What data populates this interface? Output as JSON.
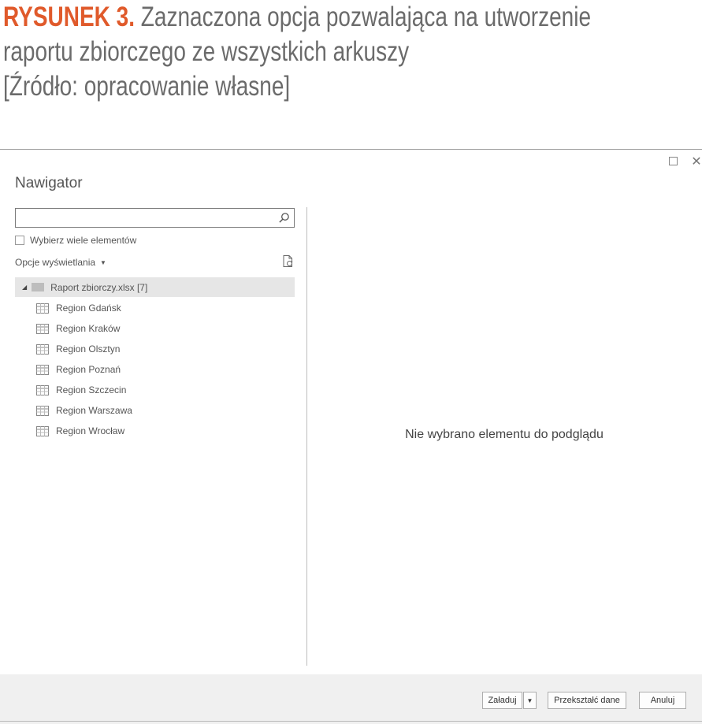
{
  "caption": {
    "figure_label": "RYSUNEK 3.",
    "line1": "Zaznaczona opcja pozwalająca na utworzenie",
    "line2": "raportu zbiorczego ze wszystkich arkuszy",
    "line3": "[Źródło: opracowanie własne]"
  },
  "window": {
    "maximize_icon": "maximize-icon",
    "close_glyph": "✕"
  },
  "navigator": {
    "title": "Nawigator",
    "search": {
      "value": "",
      "placeholder": ""
    },
    "multi_select_label": "Wybierz wiele elementów",
    "view_options_label": "Opcje wyświetlania",
    "view_options_caret": "▼",
    "tree": {
      "root_label": "Raport zbiorczy.xlsx [7]",
      "expand_glyph": "◢",
      "items": [
        {
          "label": "Region Gdańsk"
        },
        {
          "label": "Region Kraków"
        },
        {
          "label": "Region Olsztyn"
        },
        {
          "label": "Region Poznań"
        },
        {
          "label": "Region Szczecin"
        },
        {
          "label": "Region Warszawa"
        },
        {
          "label": "Region Wrocław"
        }
      ]
    }
  },
  "preview": {
    "empty_message": "Nie wybrano elementu do podglądu"
  },
  "footer": {
    "load_label": "Załaduj",
    "load_dropdown_glyph": "▼",
    "transform_label": "Przekształć dane",
    "cancel_label": "Anuluj"
  },
  "colors": {
    "figure_label": "#e05a2b",
    "caption_text": "#6b6b6b",
    "selected_row": "#e6e6e6",
    "footer_bg": "#f0f0f0"
  }
}
